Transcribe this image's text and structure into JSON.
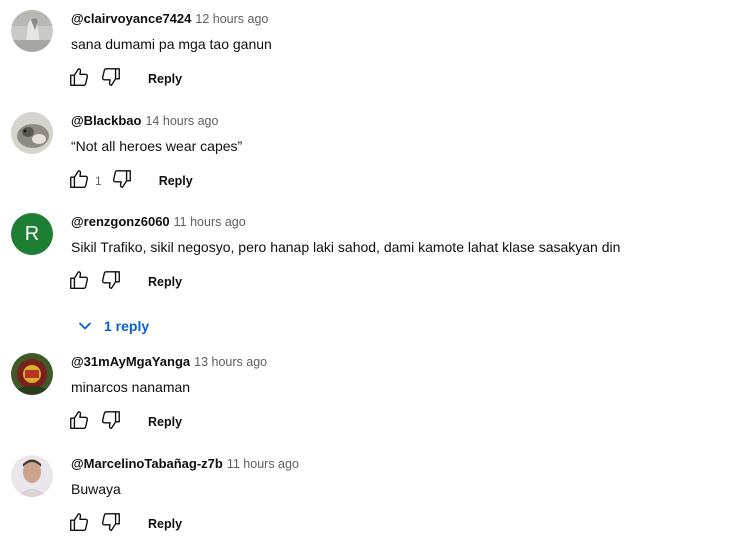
{
  "comments": [
    {
      "author": "@clairvoyance7424",
      "time": "12 hours ago",
      "text": "sana dumami pa mga tao ganun",
      "likes": "",
      "reply_label": "Reply"
    },
    {
      "author": "@Blackbao",
      "time": "14 hours ago",
      "text": "“Not all heroes wear capes”",
      "likes": "1",
      "reply_label": "Reply"
    },
    {
      "author": "@renzgonz6060",
      "time": "11 hours ago",
      "text": "Sikil Trafiko, sikil negosyo, pero hanap laki sahod, dami kamote lahat klase sasakyan din",
      "likes": "",
      "reply_label": "Reply",
      "avatar_letter": "R",
      "replies_label": "1 reply"
    },
    {
      "author": "@31mAyMgaYanga",
      "time": "13 hours ago",
      "text": "minarcos nanaman",
      "likes": "",
      "reply_label": "Reply"
    },
    {
      "author": "@MarcelinoTabañag-z7b",
      "time": "11 hours ago",
      "text": "Buwaya",
      "likes": "",
      "reply_label": "Reply"
    }
  ],
  "colors": {
    "avatar_letter_bg": "#1e7e34",
    "link_blue": "#065fd4",
    "meta_gray": "#606060"
  },
  "icons": {
    "like": "thumb-up-icon",
    "dislike": "thumb-down-icon",
    "expand": "chevron-down-icon"
  }
}
